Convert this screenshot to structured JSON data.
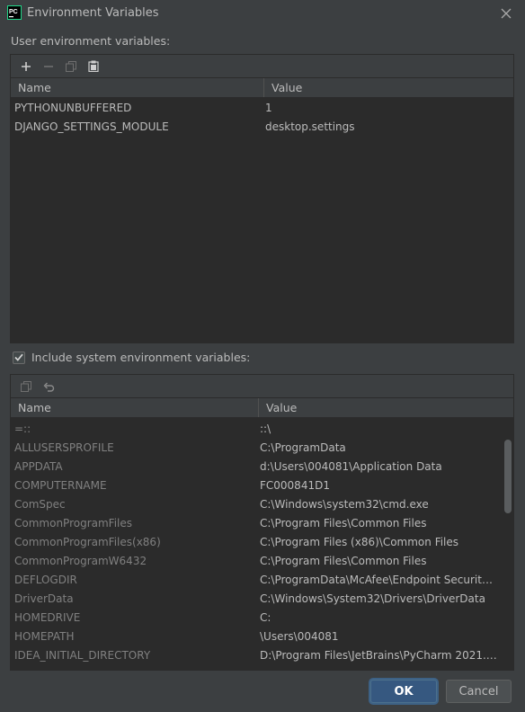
{
  "window": {
    "title": "Environment Variables",
    "app_icon_text": "PC"
  },
  "user_section": {
    "label": "User environment variables:",
    "columns": {
      "name": "Name",
      "value": "Value"
    },
    "rows": [
      {
        "name": "PYTHONUNBUFFERED",
        "value": "1"
      },
      {
        "name": "DJANGO_SETTINGS_MODULE",
        "value": "desktop.settings"
      }
    ]
  },
  "include_system": {
    "label": "Include system environment variables:",
    "checked": true
  },
  "system_section": {
    "columns": {
      "name": "Name",
      "value": "Value"
    },
    "rows": [
      {
        "name": "=::",
        "value": "::\\"
      },
      {
        "name": "ALLUSERSPROFILE",
        "value": "C:\\ProgramData"
      },
      {
        "name": "APPDATA",
        "value": "d:\\Users\\004081\\Application Data"
      },
      {
        "name": "COMPUTERNAME",
        "value": "FC000841D1"
      },
      {
        "name": "ComSpec",
        "value": "C:\\Windows\\system32\\cmd.exe"
      },
      {
        "name": "CommonProgramFiles",
        "value": "C:\\Program Files\\Common Files"
      },
      {
        "name": "CommonProgramFiles(x86)",
        "value": "C:\\Program Files (x86)\\Common Files"
      },
      {
        "name": "CommonProgramW6432",
        "value": "C:\\Program Files\\Common Files"
      },
      {
        "name": "DEFLOGDIR",
        "value": "C:\\ProgramData\\McAfee\\Endpoint Security\\..."
      },
      {
        "name": "DriverData",
        "value": "C:\\Windows\\System32\\Drivers\\DriverData"
      },
      {
        "name": "HOMEDRIVE",
        "value": "C:"
      },
      {
        "name": "HOMEPATH",
        "value": "\\Users\\004081"
      },
      {
        "name": "IDEA_INITIAL_DIRECTORY",
        "value": "D:\\Program Files\\JetBrains\\PyCharm 2021.1...."
      }
    ]
  },
  "buttons": {
    "ok": "OK",
    "cancel": "Cancel"
  },
  "colors": {
    "accent": "#365880",
    "background": "#3c3f41",
    "table_bg": "#2b2b2b",
    "checkmark": "#bbbbbb"
  },
  "icons": {
    "toolbar_user": [
      "add-icon",
      "remove-icon",
      "copy-icon",
      "paste-icon"
    ],
    "toolbar_system": [
      "copy-icon",
      "undo-icon"
    ]
  }
}
